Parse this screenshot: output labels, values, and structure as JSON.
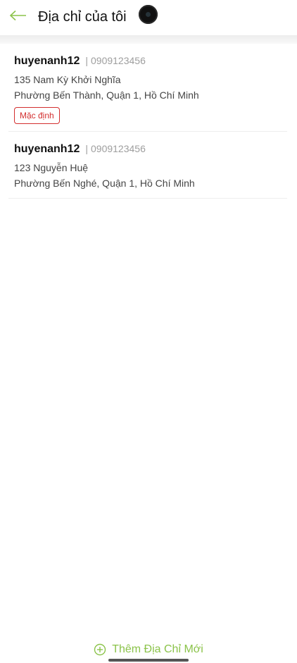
{
  "header": {
    "title": "Địa chỉ của tôi",
    "back_icon": "arrow-left-icon"
  },
  "addresses": [
    {
      "name": "huyenanh12",
      "separator": "|",
      "phone": "0909123456",
      "line1": "135 Nam Kỳ Khởi Nghĩa",
      "line2": "Phường Bến Thành, Quận 1, Hồ Chí Minh",
      "badge": "Mặc định"
    },
    {
      "name": "huyenanh12",
      "separator": "|",
      "phone": "0909123456",
      "line1": "123 Nguyễn Huệ",
      "line2": "Phường Bến Nghé, Quận 1, Hồ Chí Minh"
    }
  ],
  "footer": {
    "add_label": "Thêm Địa Chỉ Mới",
    "add_icon": "plus-circle-icon"
  },
  "colors": {
    "accent": "#8bc34a",
    "badge": "#d32f2f",
    "muted": "#9e9e9e"
  }
}
